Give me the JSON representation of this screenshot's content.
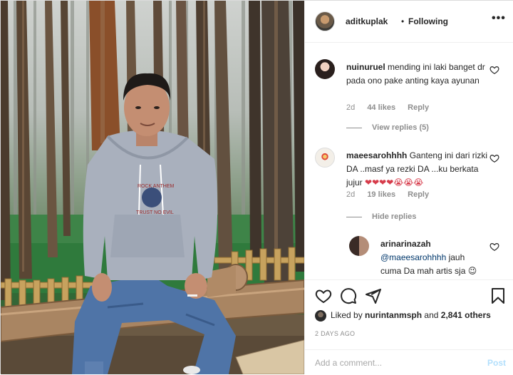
{
  "post": {
    "author": "aditkuplak",
    "separator": "•",
    "follow_status": "Following",
    "more_label": "•••"
  },
  "comments": [
    {
      "username": "nuinuruel",
      "text": "mending ini laki banget dr pada ono pake anting kaya ayunan",
      "age": "2d",
      "likes": "44 likes",
      "reply_label": "Reply",
      "replies_toggle": "View replies (5)"
    },
    {
      "username": "maeesarohhhh",
      "text": "Ganteng ini dari rizki DA ..masf ya rezki DA ...ku berkata jujur",
      "emoji": "❤❤❤❤😭😭😭",
      "age": "2d",
      "likes": "19 likes",
      "reply_label": "Reply",
      "replies_toggle": "Hide replies"
    }
  ],
  "reply": {
    "username": "arinarinazah",
    "mention": "@maeesarohhhh",
    "text": "jauh cuma Da mah artis sja 😉",
    "extra_emoji": "😂"
  },
  "likes_line": {
    "prefix": "Liked by",
    "user": "nurintanmsph",
    "conjunction": "and",
    "count": "2,841 others"
  },
  "timestamp": "2 DAYS AGO",
  "comment_box": {
    "placeholder": "Add a comment...",
    "post_label": "Post"
  },
  "photo": {
    "shirt_print_lines": [
      "ROCK ANTHEM",
      "20",
      "TRUST NO EVIL"
    ]
  },
  "colors": {
    "link_muted": "#8e8e8e",
    "post_button": "#b2dffc",
    "text": "#262626"
  },
  "icons": [
    "more-icon",
    "heart-icon",
    "comment-icon",
    "share-icon",
    "bookmark-icon"
  ]
}
